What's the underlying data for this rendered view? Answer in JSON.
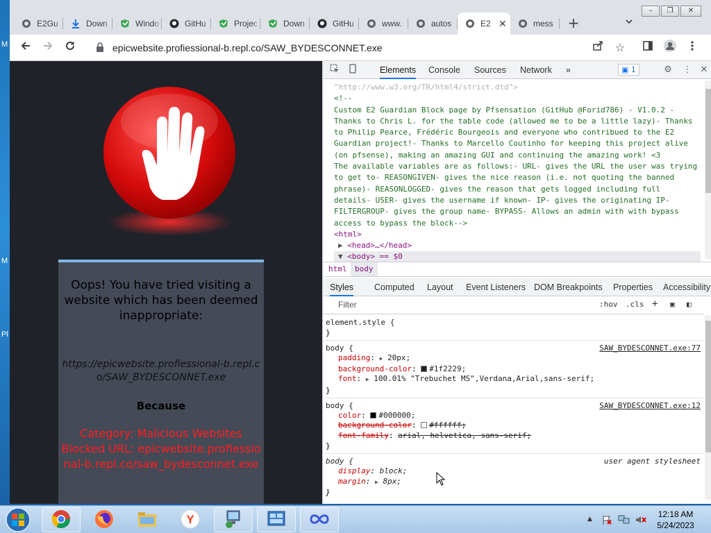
{
  "desktop": {
    "edge_letters": [
      "M",
      "M",
      "Pl"
    ]
  },
  "window_controls": {
    "minimize": "–",
    "restore": "❐",
    "close": "✕"
  },
  "tabs": [
    {
      "label": "E2Gu",
      "icon": "globe-icon"
    },
    {
      "label": "Down",
      "icon": "download-icon"
    },
    {
      "label": "Windo",
      "icon": "green-logo-icon"
    },
    {
      "label": "GitHu",
      "icon": "github-icon"
    },
    {
      "label": "Projec",
      "icon": "green-logo-icon"
    },
    {
      "label": "Down",
      "icon": "green-logo-icon"
    },
    {
      "label": "GitHu",
      "icon": "github-icon"
    },
    {
      "label": "www.",
      "icon": "globe-icon"
    },
    {
      "label": "autos",
      "icon": "globe-icon"
    },
    {
      "label": "E2",
      "icon": "globe-icon",
      "active": true
    },
    {
      "label": "mess",
      "icon": "globe-icon"
    }
  ],
  "toolbar": {
    "url": "epicwebsite.profiessional-b.repl.co/SAW_BYDESCONNET.exe"
  },
  "page": {
    "title": "Oops! You have tried visiting a website which has been deemed inappropriate:",
    "blocked_url": "https://epicwebsite.profiessional-b.repl.co/SAW_BYDESCONNET.exe",
    "because": "Because",
    "category": "Category: Malicious Websites",
    "blocked_line": "Blocked URL: epicwebsite.profiessional-b.repl.co/saw_bydesconnet.exe"
  },
  "devtools": {
    "tabs": [
      "Elements",
      "Console",
      "Sources",
      "Network"
    ],
    "more_tabs": "»",
    "issues_count": "1",
    "dom": {
      "doctype_tail": "\"http://www.w3.org/TR/html4/strict.dtd\">",
      "comment_open": "<!--",
      "comment_body": "Custom E2 Guardian Block page by Pfsensation (GitHub @Forid786) - V1.0.2 - Thanks to Chris L. for the table code (allowed me to be a little lazy)- Thanks to Philip Pearce, Frédéric Bourgeois and everyone who contribued to the E2 Guardian project!- Thanks to Marcello Coutinho for keeping this project alive (on pfsense), making an amazing GUI and continuing the amazing work! <3\nThe available variables are as follows:- URL- gives the URL the user was trying to get to- REASONGIVEN- gives the nice reason (i.e. not quoting the banned phrase)- REASONLOGGED- gives the reason that gets logged including full details- USER- gives the username if known- IP- gives the originating IP- FILTERGROUP- gives the group name- BYPASS- Allows an admin with with bypass access to bypass the block-->",
      "html_open": "<html>",
      "head_collapsed": "<head>…</head>",
      "body_line": "<body> == $0"
    },
    "breadcrumbs": [
      "html",
      "body"
    ],
    "style_tabs": [
      "Styles",
      "Computed",
      "Layout",
      "Event Listeners",
      "DOM Breakpoints",
      "Properties",
      "Accessibility"
    ],
    "filter_placeholder": "Filter",
    "filter_buttons": [
      ":hov",
      ".cls",
      "+"
    ],
    "rules": {
      "element_style": "element.style {",
      "r1": {
        "selector": "body {",
        "origin": "SAW_BYDESCONNET.exe:77",
        "padding_name": "padding",
        "padding_val": "20px;",
        "bg_name": "background-color",
        "bg_val": "#1f2229;",
        "font_name": "font",
        "font_val": "100.01% \"Trebuchet MS\",Verdana,Arial,sans-serif;"
      },
      "r2": {
        "selector": "body {",
        "origin": "SAW_BYDESCONNET.exe:12",
        "color_name": "color",
        "color_val": "#000000;",
        "bg_name": "background-color",
        "bg_val": "#ffffff;",
        "ff_name": "font-family",
        "ff_val": "arial, helvetica, sans-serif;"
      },
      "r3": {
        "selector": "body {",
        "origin": "user agent stylesheet",
        "display_name": "display",
        "display_val": "block;",
        "margin_name": "margin",
        "margin_val": "8px;"
      },
      "close": "}"
    },
    "colors": {
      "r1_bg": "#1f2229",
      "r2_color": "#000000",
      "r2_bg": "#ffffff"
    }
  },
  "taskbar": {
    "time": "12:18 AM",
    "date": "5/24/2023",
    "apps": [
      "chrome-icon",
      "firefox-icon",
      "explorer-icon",
      "yandex-icon",
      "network-icon",
      "control-panel-icon",
      "infinity-icon"
    ]
  }
}
